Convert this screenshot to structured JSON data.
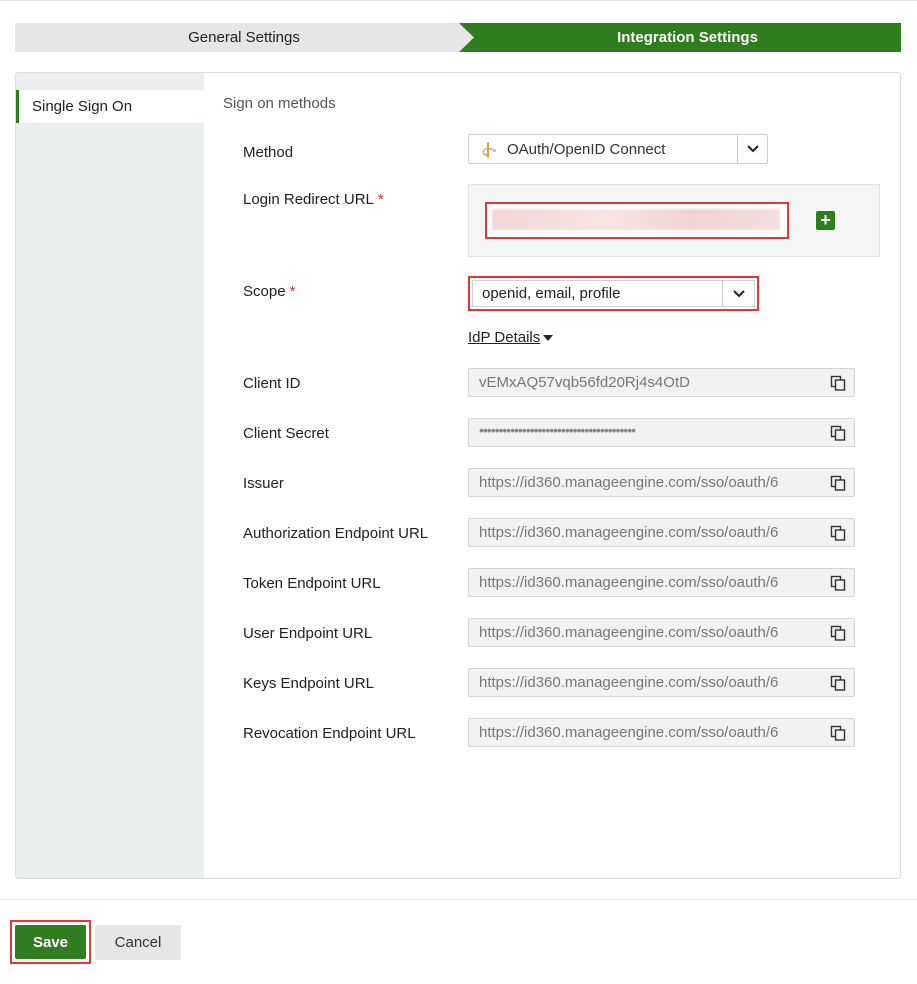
{
  "steps": {
    "general": "General Settings",
    "integration": "Integration Settings"
  },
  "sidebar": {
    "items": [
      {
        "label": "Single Sign On"
      }
    ]
  },
  "form": {
    "section_title": "Sign on methods",
    "method": {
      "label": "Method",
      "value": "OAuth/OpenID Connect",
      "icon": "openid-icon"
    },
    "login_redirect": {
      "label": "Login Redirect URL",
      "required_mark": "*"
    },
    "scope": {
      "label": "Scope",
      "required_mark": "*",
      "value": "openid, email, profile"
    },
    "idp_details_label": "IdP Details",
    "fields": [
      {
        "label": "Client ID",
        "value": "vEMxAQ57vqb56fd20Rj4s4OtD"
      },
      {
        "label": "Client Secret",
        "value": "••••••••••••••••••••••••••••••••••••••••"
      },
      {
        "label": "Issuer",
        "value": "https://id360.manageengine.com/sso/oauth/6"
      },
      {
        "label": "Authorization Endpoint URL",
        "value": "https://id360.manageengine.com/sso/oauth/6"
      },
      {
        "label": "Token Endpoint URL",
        "value": "https://id360.manageengine.com/sso/oauth/6"
      },
      {
        "label": "User Endpoint URL",
        "value": "https://id360.manageengine.com/sso/oauth/6"
      },
      {
        "label": "Keys Endpoint URL",
        "value": "https://id360.manageengine.com/sso/oauth/6"
      },
      {
        "label": "Revocation Endpoint URL",
        "value": "https://id360.manageengine.com/sso/oauth/6"
      }
    ]
  },
  "footer": {
    "save_label": "Save",
    "cancel_label": "Cancel"
  },
  "colors": {
    "accent_green": "#2f7d1f",
    "highlight_red": "#e2373b"
  }
}
